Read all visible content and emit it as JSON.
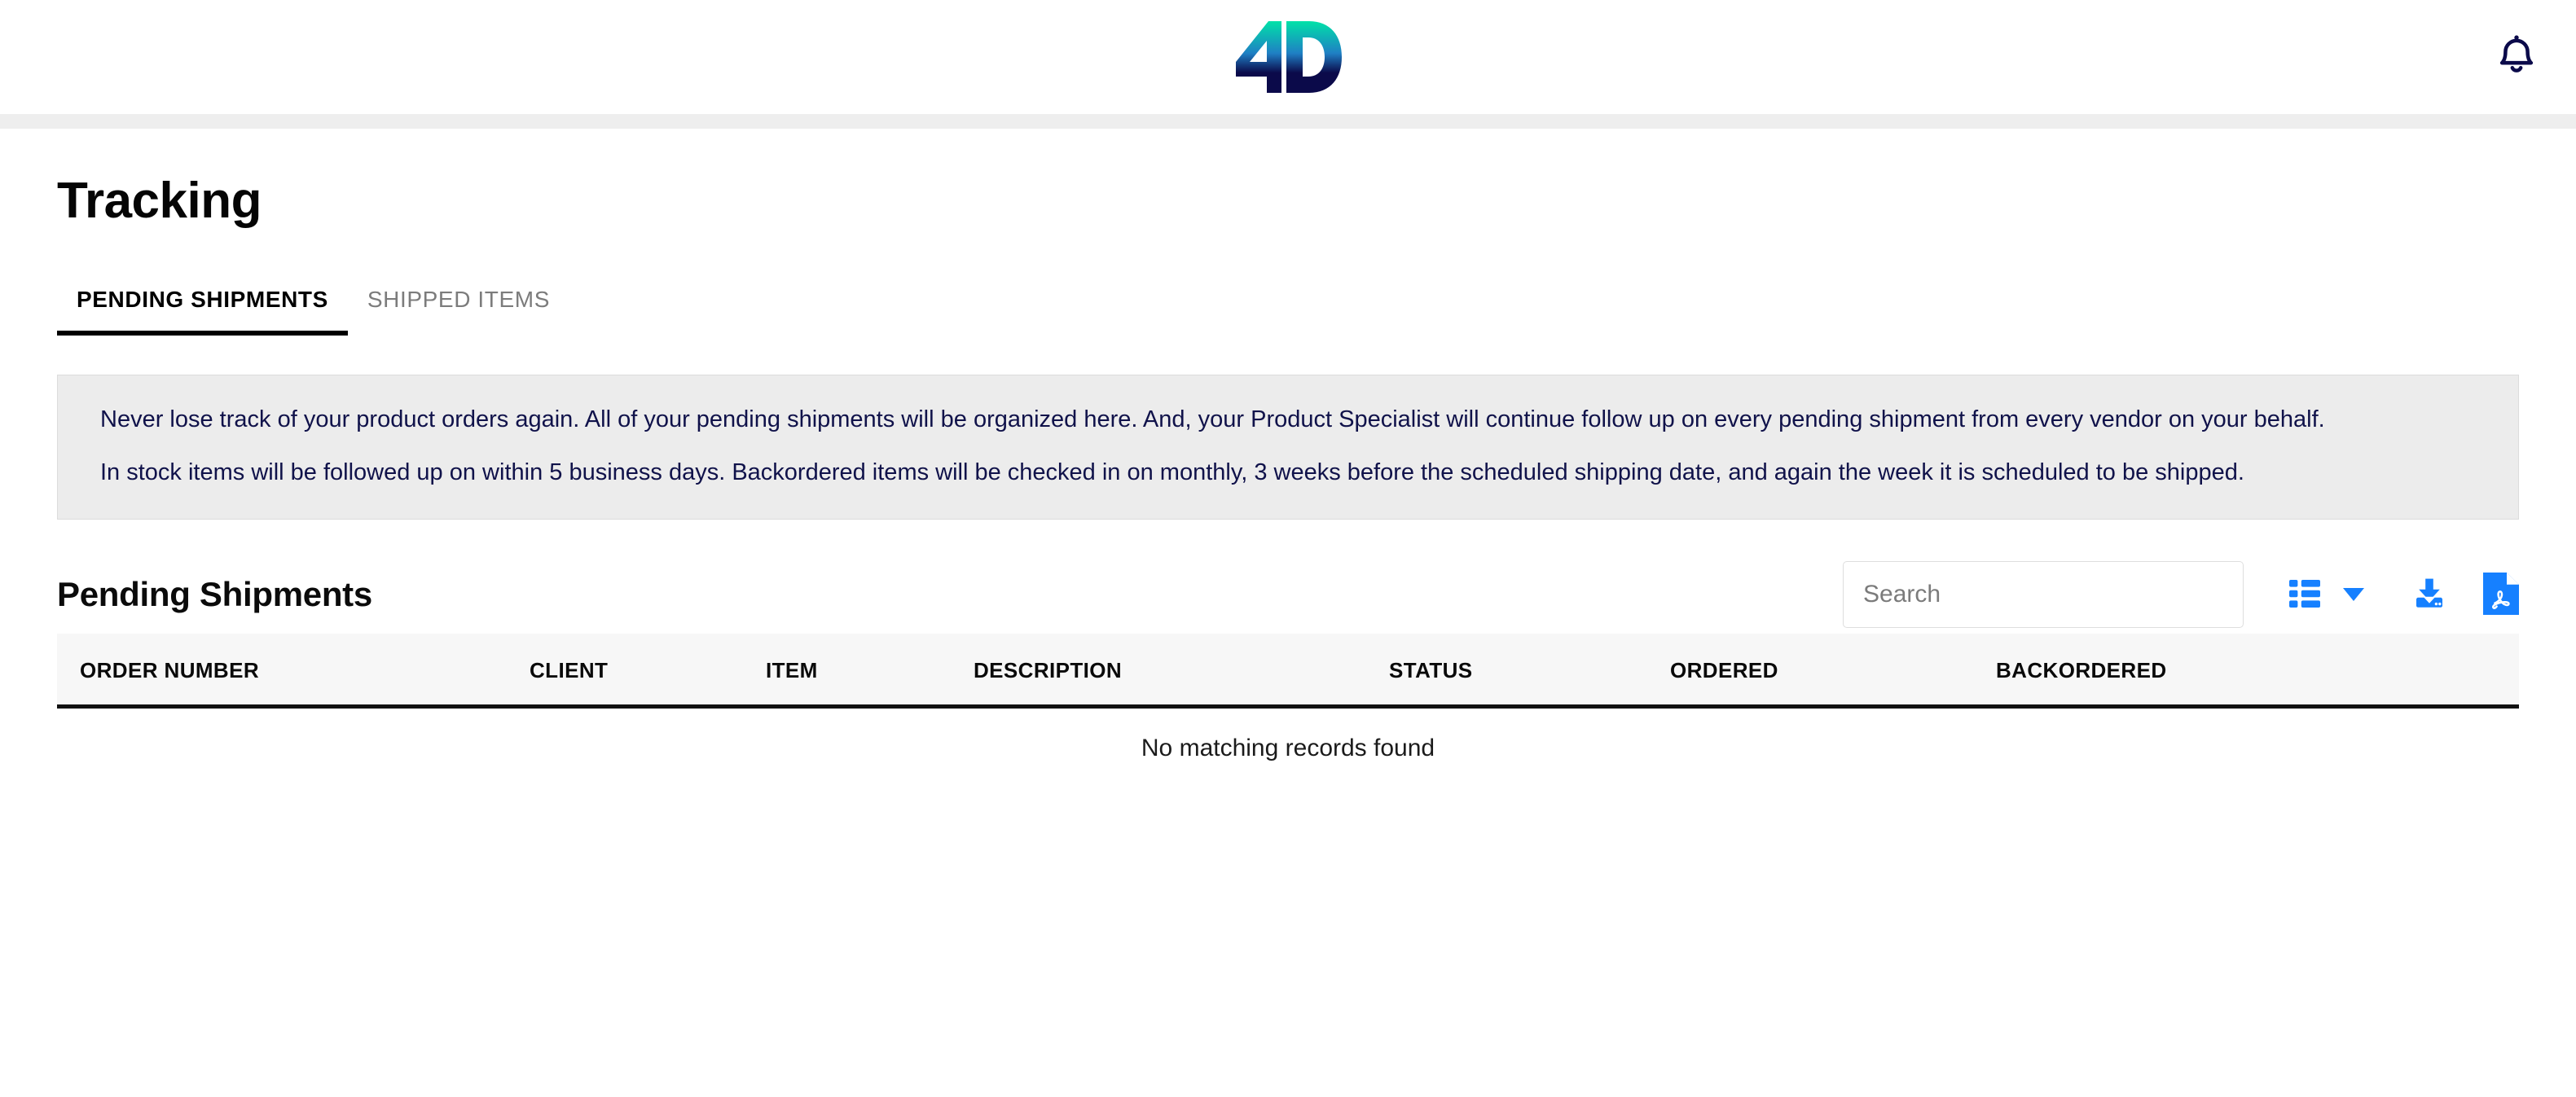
{
  "appbar": {
    "logo_text": "4D",
    "logo_name": "4d-logo",
    "logo_colors": {
      "top": "#00e2a8",
      "mid": "#1f7fc4",
      "bottom": "#0b0a4a"
    },
    "bell_icon": "notification-bell-icon",
    "bell_color": "#0b0a4a"
  },
  "page": {
    "title": "Tracking"
  },
  "tabs": [
    {
      "label": "PENDING SHIPMENTS",
      "active": true
    },
    {
      "label": "SHIPPED ITEMS",
      "active": false
    }
  ],
  "info_panel": {
    "paragraph_1": "Never lose track of your product orders again. All of your pending shipments will be organized here. And, your Product Specialist will continue follow up on every pending shipment from every vendor on your behalf.",
    "paragraph_2": "In stock items will be followed up on within 5 business days. Backordered items will be checked in on monthly, 3 weeks before the scheduled shipping date, and again the week it is scheduled to be shipped.",
    "background_color": "#ececec",
    "text_color": "#10124a"
  },
  "section": {
    "title": "Pending Shipments"
  },
  "search": {
    "value": "",
    "placeholder": "Search"
  },
  "toolbar": {
    "accent_color": "#1680ff",
    "columns_icon": "column-visibility-icon",
    "columns_caret_icon": "chevron-down-icon",
    "excel_icon": "download-export-icon",
    "pdf_icon": "pdf-export-icon"
  },
  "table": {
    "columns": [
      "ORDER NUMBER",
      "CLIENT",
      "ITEM",
      "DESCRIPTION",
      "STATUS",
      "ORDERED",
      "BACKORDERED"
    ],
    "rows": [],
    "empty_message": "No matching records found"
  }
}
